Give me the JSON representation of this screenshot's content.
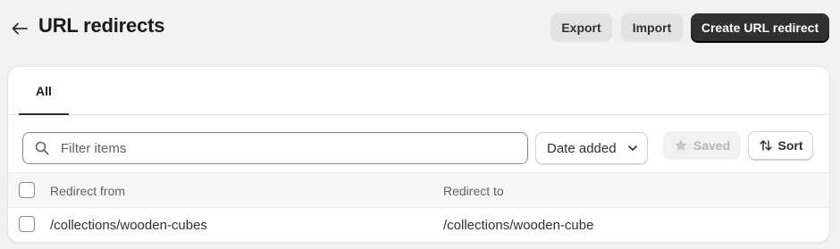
{
  "header": {
    "title": "URL redirects",
    "back_icon": "arrow-left-icon",
    "export_label": "Export",
    "import_label": "Import",
    "create_label": "Create URL redirect"
  },
  "tabs": [
    {
      "label": "All",
      "selected": true
    }
  ],
  "filters": {
    "search_placeholder": "Filter items",
    "search_value": "",
    "date_select_value": "Date added",
    "saved_label": "Saved",
    "sort_label": "Sort"
  },
  "table": {
    "columns": [
      "Redirect from",
      "Redirect to"
    ],
    "rows": [
      {
        "from": "/collections/wooden-cubes",
        "to": "/collections/wooden-cube"
      }
    ]
  },
  "colors": {
    "background": "#f1f1f1",
    "primary_button": "#303030",
    "card": "#ffffff"
  }
}
